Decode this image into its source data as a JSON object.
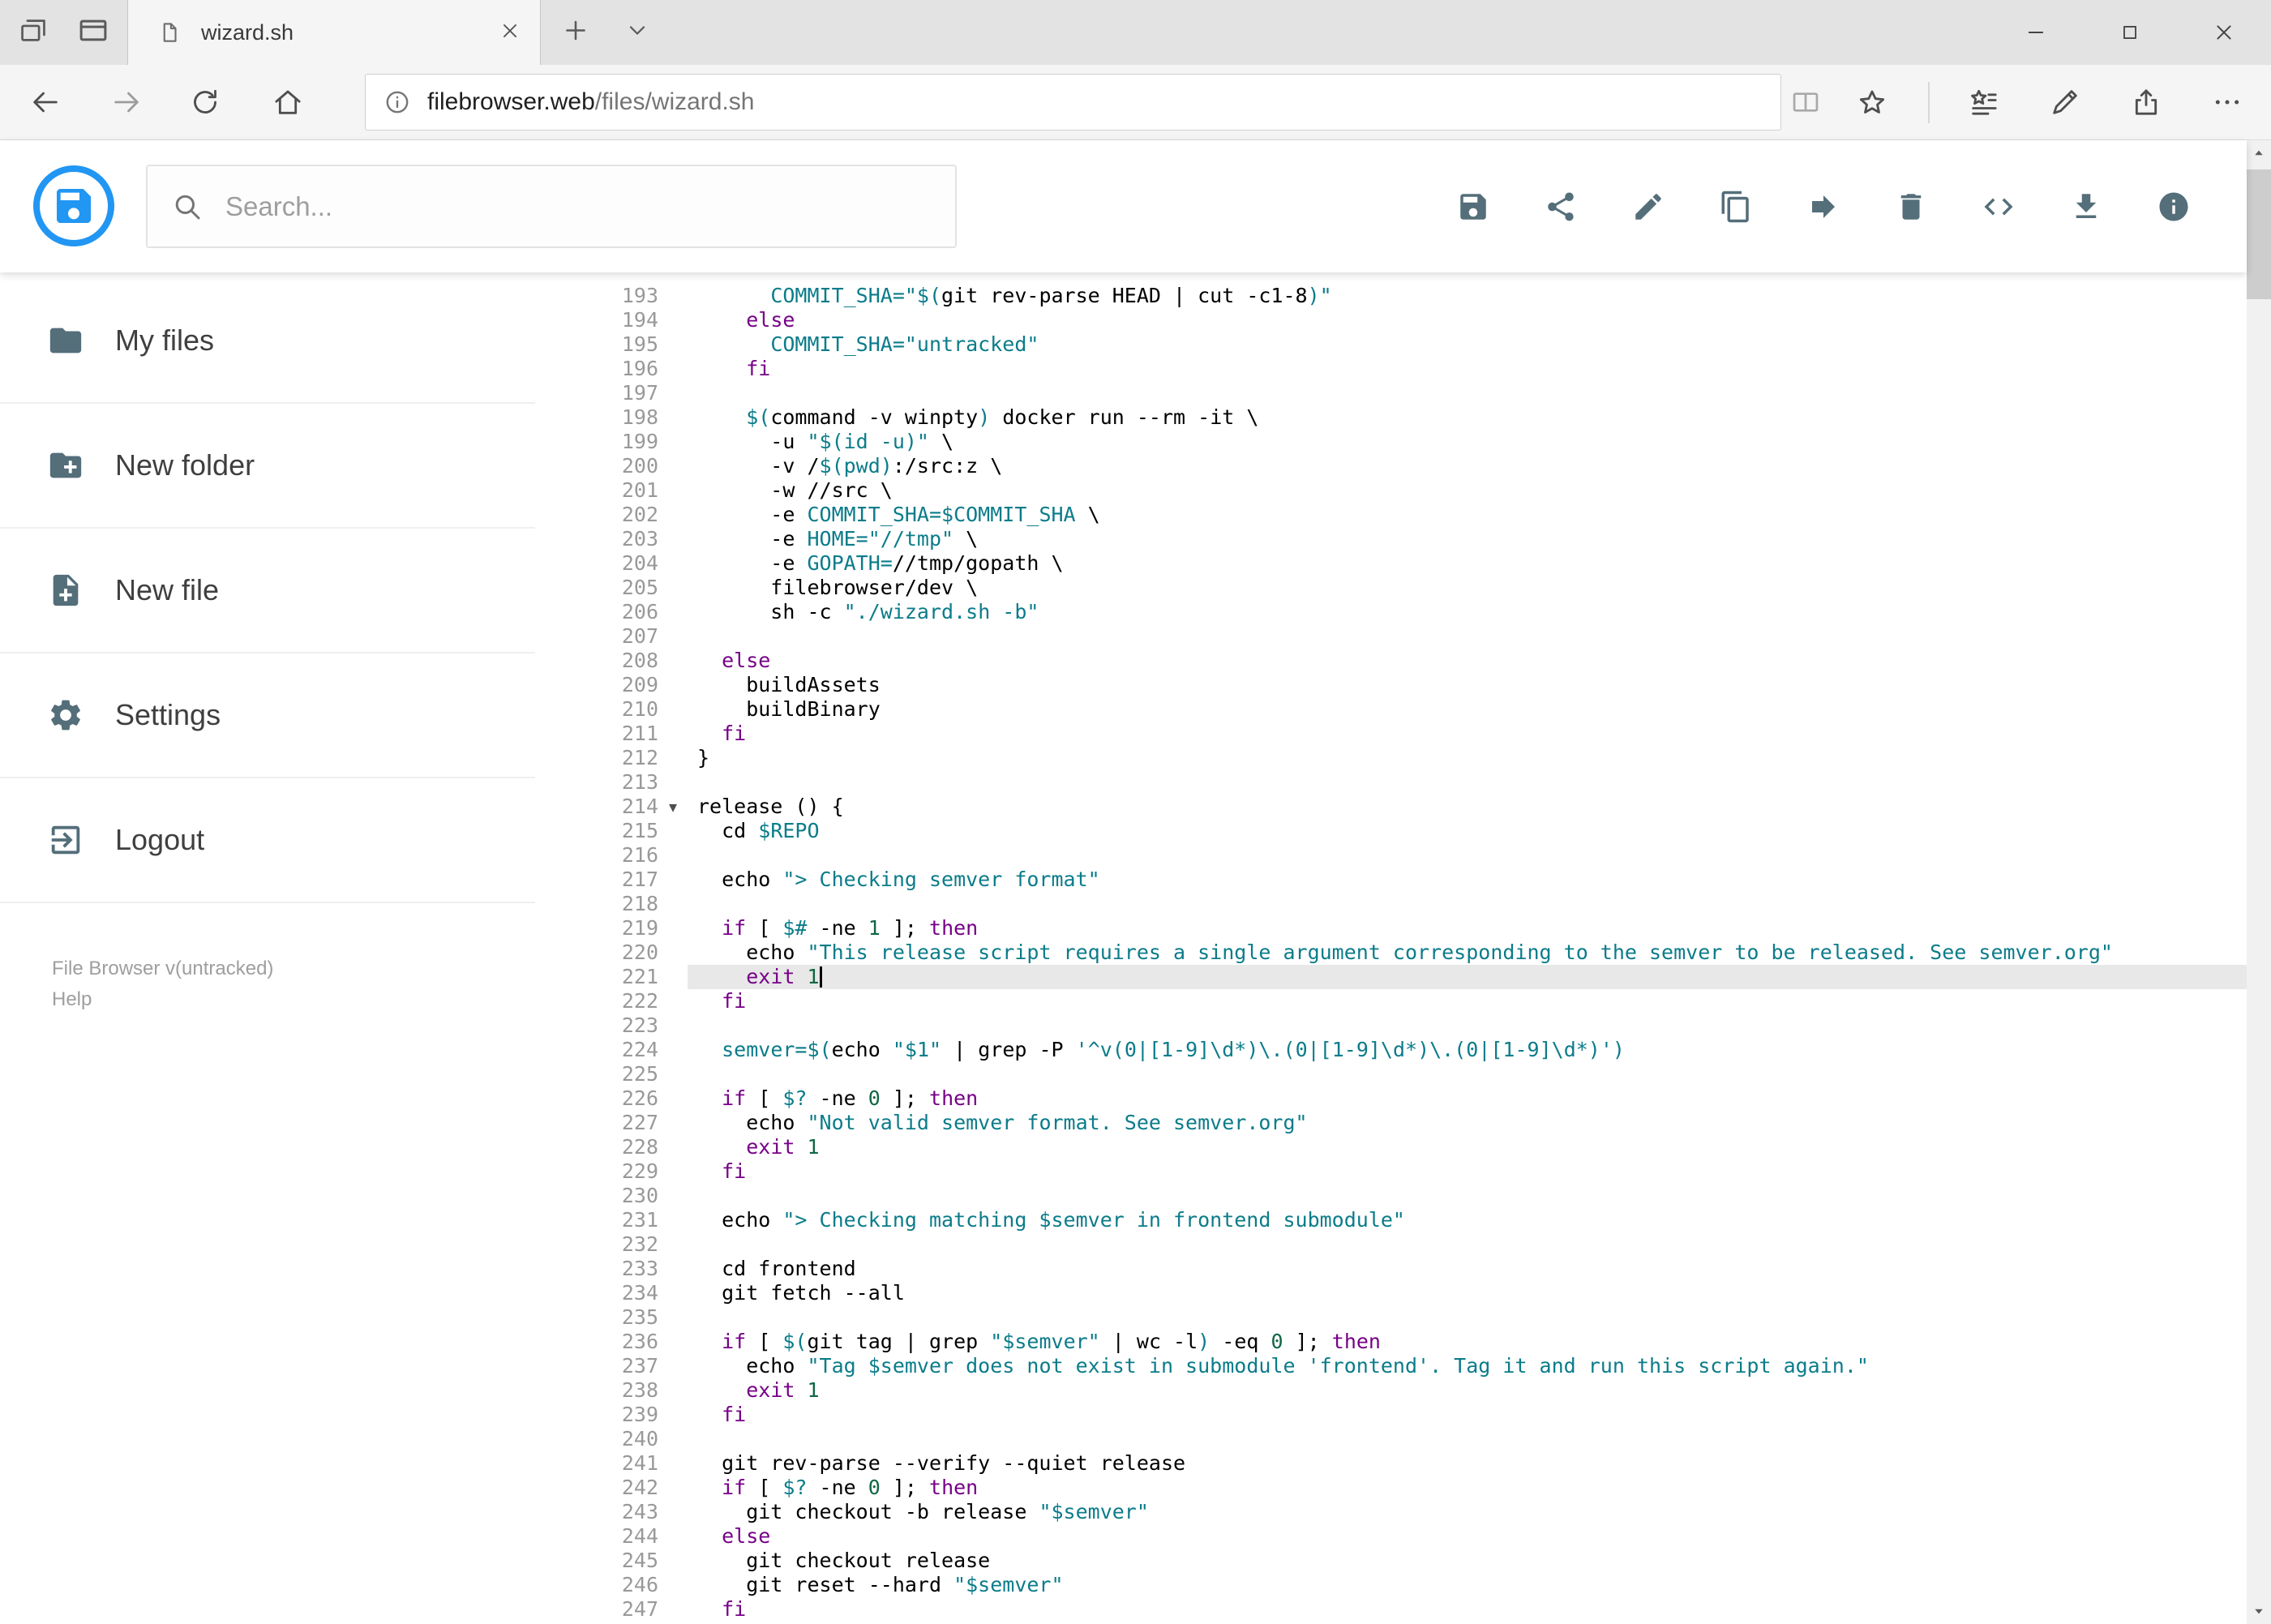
{
  "browser": {
    "tab": {
      "title": "wizard.sh"
    },
    "url": {
      "host": "filebrowser.web",
      "path": "/files/wizard.sh"
    }
  },
  "app": {
    "search": {
      "placeholder": "Search..."
    },
    "toolbar": [
      {
        "name": "save"
      },
      {
        "name": "share"
      },
      {
        "name": "rename"
      },
      {
        "name": "copy"
      },
      {
        "name": "move"
      },
      {
        "name": "delete"
      },
      {
        "name": "raw"
      },
      {
        "name": "download"
      },
      {
        "name": "info"
      }
    ],
    "sidebar": {
      "items": [
        {
          "id": "my-files",
          "label": "My files",
          "icon": "folder"
        },
        {
          "id": "new-folder",
          "label": "New folder",
          "icon": "new-folder"
        },
        {
          "id": "new-file",
          "label": "New file",
          "icon": "new-file"
        },
        {
          "id": "settings",
          "label": "Settings",
          "icon": "settings"
        },
        {
          "id": "logout",
          "label": "Logout",
          "icon": "logout"
        }
      ],
      "footer": {
        "version": "File Browser v(untracked)",
        "help": "Help"
      }
    }
  },
  "editor": {
    "language": "shell",
    "first_line_number": 193,
    "active_line": 221,
    "cursor": {
      "line": 221,
      "column": 10
    },
    "folded_lines": [
      214
    ],
    "colors": {
      "keyword": "#770088",
      "string": "#0b7c8a",
      "number": "#116644",
      "text": "#000000",
      "line_number": "#999999",
      "active_line_bg": "#e8e8e8",
      "accent": "#2196f3"
    },
    "lines": [
      {
        "n": 193,
        "t": [
          [
            "p",
            "      "
          ],
          [
            "s",
            "COMMIT_SHA=\"$("
          ],
          [
            "p",
            "git rev-parse HEAD | cut -c1-8"
          ],
          [
            "s",
            ")\""
          ]
        ]
      },
      {
        "n": 194,
        "t": [
          [
            "p",
            "    "
          ],
          [
            "k",
            "else"
          ]
        ]
      },
      {
        "n": 195,
        "t": [
          [
            "p",
            "      "
          ],
          [
            "s",
            "COMMIT_SHA=\"untracked\""
          ]
        ]
      },
      {
        "n": 196,
        "t": [
          [
            "p",
            "    "
          ],
          [
            "k",
            "fi"
          ]
        ]
      },
      {
        "n": 197,
        "t": []
      },
      {
        "n": 198,
        "t": [
          [
            "p",
            "    "
          ],
          [
            "s",
            "$("
          ],
          [
            "p",
            "command -v winpty"
          ],
          [
            "s",
            ")"
          ],
          [
            "p",
            " docker run --rm -it \\"
          ]
        ]
      },
      {
        "n": 199,
        "t": [
          [
            "p",
            "      -u "
          ],
          [
            "s",
            "\"$(id -u)\""
          ],
          [
            "p",
            " \\"
          ]
        ]
      },
      {
        "n": 200,
        "t": [
          [
            "p",
            "      -v /"
          ],
          [
            "s",
            "$(pwd)"
          ],
          [
            "p",
            ":/src:z \\"
          ]
        ]
      },
      {
        "n": 201,
        "t": [
          [
            "p",
            "      -w //src \\"
          ]
        ]
      },
      {
        "n": 202,
        "t": [
          [
            "p",
            "      -e "
          ],
          [
            "s",
            "COMMIT_SHA=$COMMIT_SHA"
          ],
          [
            "p",
            " \\"
          ]
        ]
      },
      {
        "n": 203,
        "t": [
          [
            "p",
            "      -e "
          ],
          [
            "s",
            "HOME=\"//tmp\""
          ],
          [
            "p",
            " \\"
          ]
        ]
      },
      {
        "n": 204,
        "t": [
          [
            "p",
            "      -e "
          ],
          [
            "s",
            "GOPATH="
          ],
          [
            "p",
            "//tmp/gopath \\"
          ]
        ]
      },
      {
        "n": 205,
        "t": [
          [
            "p",
            "      filebrowser/dev \\"
          ]
        ]
      },
      {
        "n": 206,
        "t": [
          [
            "p",
            "      sh -c "
          ],
          [
            "s",
            "\"./wizard.sh -b\""
          ]
        ]
      },
      {
        "n": 207,
        "t": []
      },
      {
        "n": 208,
        "t": [
          [
            "p",
            "  "
          ],
          [
            "k",
            "else"
          ]
        ]
      },
      {
        "n": 209,
        "t": [
          [
            "p",
            "    buildAssets"
          ]
        ]
      },
      {
        "n": 210,
        "t": [
          [
            "p",
            "    buildBinary"
          ]
        ]
      },
      {
        "n": 211,
        "t": [
          [
            "p",
            "  "
          ],
          [
            "k",
            "fi"
          ]
        ]
      },
      {
        "n": 212,
        "t": [
          [
            "p",
            "}"
          ]
        ]
      },
      {
        "n": 213,
        "t": []
      },
      {
        "n": 214,
        "t": [
          [
            "p",
            "release () {"
          ]
        ]
      },
      {
        "n": 215,
        "t": [
          [
            "p",
            "  cd "
          ],
          [
            "s",
            "$REPO"
          ]
        ]
      },
      {
        "n": 216,
        "t": []
      },
      {
        "n": 217,
        "t": [
          [
            "p",
            "  echo "
          ],
          [
            "s",
            "\"> Checking semver format\""
          ]
        ]
      },
      {
        "n": 218,
        "t": []
      },
      {
        "n": 219,
        "t": [
          [
            "p",
            "  "
          ],
          [
            "k",
            "if"
          ],
          [
            "p",
            " [ "
          ],
          [
            "s",
            "$#"
          ],
          [
            "p",
            " -ne "
          ],
          [
            "n",
            "1"
          ],
          [
            "p",
            " ]; "
          ],
          [
            "k",
            "then"
          ]
        ]
      },
      {
        "n": 220,
        "t": [
          [
            "p",
            "    echo "
          ],
          [
            "s",
            "\"This release script requires a single argument corresponding to the semver to be released. See semver.org\""
          ]
        ]
      },
      {
        "n": 221,
        "t": [
          [
            "p",
            "    "
          ],
          [
            "k",
            "exit"
          ],
          [
            "p",
            " "
          ],
          [
            "n",
            "1"
          ]
        ]
      },
      {
        "n": 222,
        "t": [
          [
            "p",
            "  "
          ],
          [
            "k",
            "fi"
          ]
        ]
      },
      {
        "n": 223,
        "t": []
      },
      {
        "n": 224,
        "t": [
          [
            "p",
            "  "
          ],
          [
            "s",
            "semver=$("
          ],
          [
            "p",
            "echo "
          ],
          [
            "s",
            "\"$1\""
          ],
          [
            "p",
            " | grep -P "
          ],
          [
            "s",
            "'^v(0|[1-9]\\d*)\\.(0|[1-9]\\d*)\\.(0|[1-9]\\d*)'"
          ],
          [
            "s",
            ")"
          ]
        ]
      },
      {
        "n": 225,
        "t": []
      },
      {
        "n": 226,
        "t": [
          [
            "p",
            "  "
          ],
          [
            "k",
            "if"
          ],
          [
            "p",
            " [ "
          ],
          [
            "s",
            "$?"
          ],
          [
            "p",
            " -ne "
          ],
          [
            "n",
            "0"
          ],
          [
            "p",
            " ]; "
          ],
          [
            "k",
            "then"
          ]
        ]
      },
      {
        "n": 227,
        "t": [
          [
            "p",
            "    echo "
          ],
          [
            "s",
            "\"Not valid semver format. See semver.org\""
          ]
        ]
      },
      {
        "n": 228,
        "t": [
          [
            "p",
            "    "
          ],
          [
            "k",
            "exit"
          ],
          [
            "p",
            " "
          ],
          [
            "n",
            "1"
          ]
        ]
      },
      {
        "n": 229,
        "t": [
          [
            "p",
            "  "
          ],
          [
            "k",
            "fi"
          ]
        ]
      },
      {
        "n": 230,
        "t": []
      },
      {
        "n": 231,
        "t": [
          [
            "p",
            "  echo "
          ],
          [
            "s",
            "\"> Checking matching $semver in frontend submodule\""
          ]
        ]
      },
      {
        "n": 232,
        "t": []
      },
      {
        "n": 233,
        "t": [
          [
            "p",
            "  cd frontend"
          ]
        ]
      },
      {
        "n": 234,
        "t": [
          [
            "p",
            "  git fetch --all"
          ]
        ]
      },
      {
        "n": 235,
        "t": []
      },
      {
        "n": 236,
        "t": [
          [
            "p",
            "  "
          ],
          [
            "k",
            "if"
          ],
          [
            "p",
            " [ "
          ],
          [
            "s",
            "$("
          ],
          [
            "p",
            "git tag | grep "
          ],
          [
            "s",
            "\"$semver\""
          ],
          [
            "p",
            " | wc -l"
          ],
          [
            "s",
            ")"
          ],
          [
            "p",
            " -eq "
          ],
          [
            "n",
            "0"
          ],
          [
            "p",
            " ]; "
          ],
          [
            "k",
            "then"
          ]
        ]
      },
      {
        "n": 237,
        "t": [
          [
            "p",
            "    echo "
          ],
          [
            "s",
            "\"Tag $semver does not exist in submodule 'frontend'. Tag it and run this script again.\""
          ]
        ]
      },
      {
        "n": 238,
        "t": [
          [
            "p",
            "    "
          ],
          [
            "k",
            "exit"
          ],
          [
            "p",
            " "
          ],
          [
            "n",
            "1"
          ]
        ]
      },
      {
        "n": 239,
        "t": [
          [
            "p",
            "  "
          ],
          [
            "k",
            "fi"
          ]
        ]
      },
      {
        "n": 240,
        "t": []
      },
      {
        "n": 241,
        "t": [
          [
            "p",
            "  git rev-parse --verify --quiet release"
          ]
        ]
      },
      {
        "n": 242,
        "t": [
          [
            "p",
            "  "
          ],
          [
            "k",
            "if"
          ],
          [
            "p",
            " [ "
          ],
          [
            "s",
            "$?"
          ],
          [
            "p",
            " -ne "
          ],
          [
            "n",
            "0"
          ],
          [
            "p",
            " ]; "
          ],
          [
            "k",
            "then"
          ]
        ]
      },
      {
        "n": 243,
        "t": [
          [
            "p",
            "    git checkout -b release "
          ],
          [
            "s",
            "\"$semver\""
          ]
        ]
      },
      {
        "n": 244,
        "t": [
          [
            "p",
            "  "
          ],
          [
            "k",
            "else"
          ]
        ]
      },
      {
        "n": 245,
        "t": [
          [
            "p",
            "    git checkout release"
          ]
        ]
      },
      {
        "n": 246,
        "t": [
          [
            "p",
            "    git reset --hard "
          ],
          [
            "s",
            "\"$semver\""
          ]
        ]
      },
      {
        "n": 247,
        "t": [
          [
            "p",
            "  "
          ],
          [
            "k",
            "fi"
          ]
        ]
      }
    ]
  }
}
